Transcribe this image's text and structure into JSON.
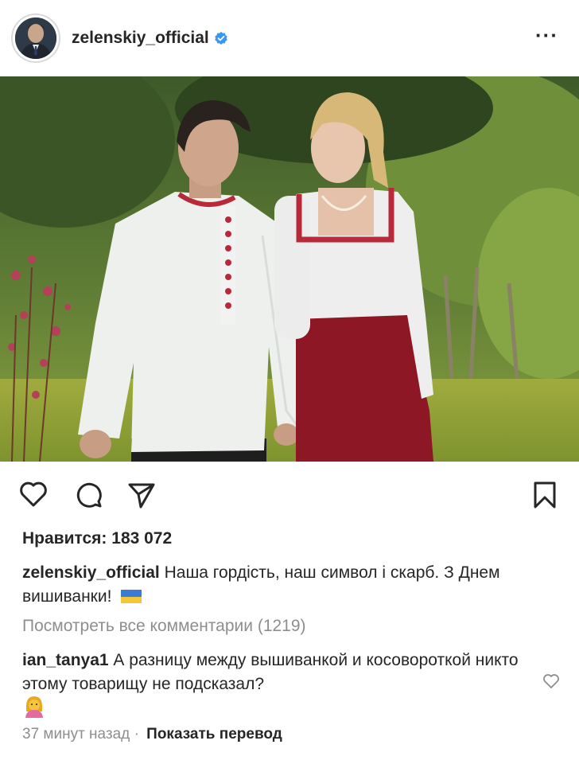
{
  "header": {
    "username": "zelenskiy_official",
    "more_label": "···",
    "verified_color": "#3897f0"
  },
  "actions": {
    "like_icon": "heart-outline-icon",
    "comment_icon": "speech-bubble-icon",
    "share_icon": "paper-plane-icon",
    "save_icon": "bookmark-icon"
  },
  "post": {
    "likes": "Нравится: 183 072",
    "caption_user": "zelenskiy_official",
    "caption_text": "Наша гордість, наш символ і скарб. З Днем вишиванки!",
    "flag_colors": [
      "#3a7bd5",
      "#f2c83a"
    ],
    "view_all": "Посмотреть все комментарии (1219)",
    "comment_user": "ian_tanya1",
    "comment_text": "А разницу между вышиванкой и косовороткой никто этому товарищу не подсказал?",
    "timestamp": "37 минут назад",
    "separator": "·",
    "translate": "Показать перевод"
  }
}
